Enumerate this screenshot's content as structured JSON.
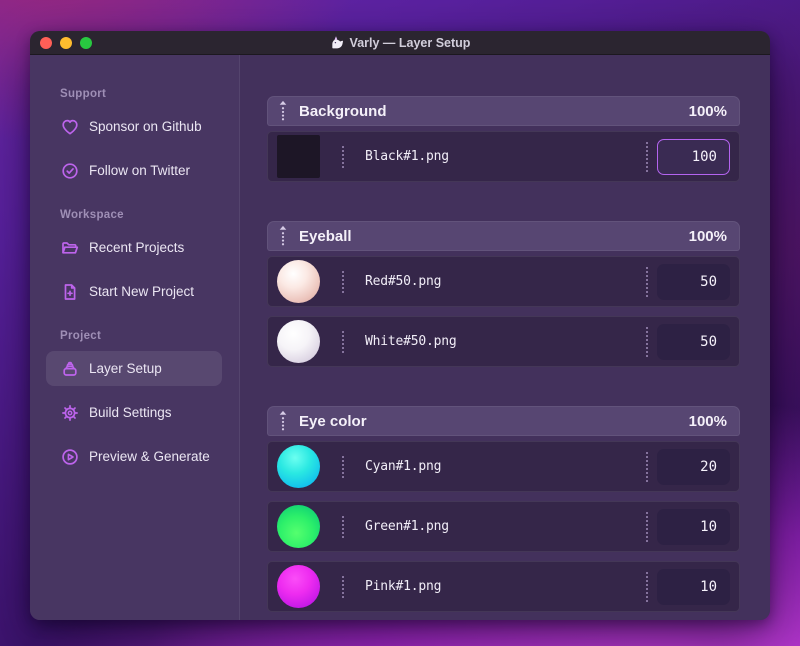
{
  "window": {
    "title": "Varly — Layer Setup",
    "traffic_lights": {
      "close": "#ff5f57",
      "minimize": "#febc2e",
      "zoom": "#28c840"
    }
  },
  "sidebar": {
    "sections": [
      {
        "label": "Support",
        "items": [
          {
            "icon": "heart-icon",
            "label": "Sponsor on Github",
            "selected": false
          },
          {
            "icon": "check-badge-icon",
            "label": "Follow on Twitter",
            "selected": false
          }
        ]
      },
      {
        "label": "Workspace",
        "items": [
          {
            "icon": "folder-icon",
            "label": "Recent Projects",
            "selected": false
          },
          {
            "icon": "file-plus-icon",
            "label": "Start New Project",
            "selected": false
          }
        ]
      },
      {
        "label": "Project",
        "items": [
          {
            "icon": "layers-icon",
            "label": "Layer Setup",
            "selected": true
          },
          {
            "icon": "gear-icon",
            "label": "Build Settings",
            "selected": false
          },
          {
            "icon": "play-circle-icon",
            "label": "Preview & Generate",
            "selected": false
          }
        ]
      }
    ]
  },
  "layers": {
    "groups": [
      {
        "name": "Background",
        "weight": "100%",
        "items": [
          {
            "thumb": "black-square",
            "filename": "Black#1.png",
            "value": "100",
            "focused": true
          }
        ]
      },
      {
        "name": "Eyeball",
        "weight": "100%",
        "items": [
          {
            "thumb": "red-sphere",
            "filename": "Red#50.png",
            "value": "50",
            "focused": false
          },
          {
            "thumb": "white-sphere",
            "filename": "White#50.png",
            "value": "50",
            "focused": false
          }
        ]
      },
      {
        "name": "Eye color",
        "weight": "100%",
        "items": [
          {
            "thumb": "cyan-sphere",
            "filename": "Cyan#1.png",
            "value": "20",
            "focused": false
          },
          {
            "thumb": "green-sphere",
            "filename": "Green#1.png",
            "value": "10",
            "focused": false
          },
          {
            "thumb": "pink-sphere",
            "filename": "Pink#1.png",
            "value": "10",
            "focused": false
          }
        ]
      }
    ]
  },
  "colors": {
    "accent": "#bd64ec",
    "focus_border": "#b464ef",
    "header_bar": "#574672",
    "row_bg": "#352649",
    "window_bg": "#43315c",
    "titlebar_bg": "#2b2530"
  }
}
